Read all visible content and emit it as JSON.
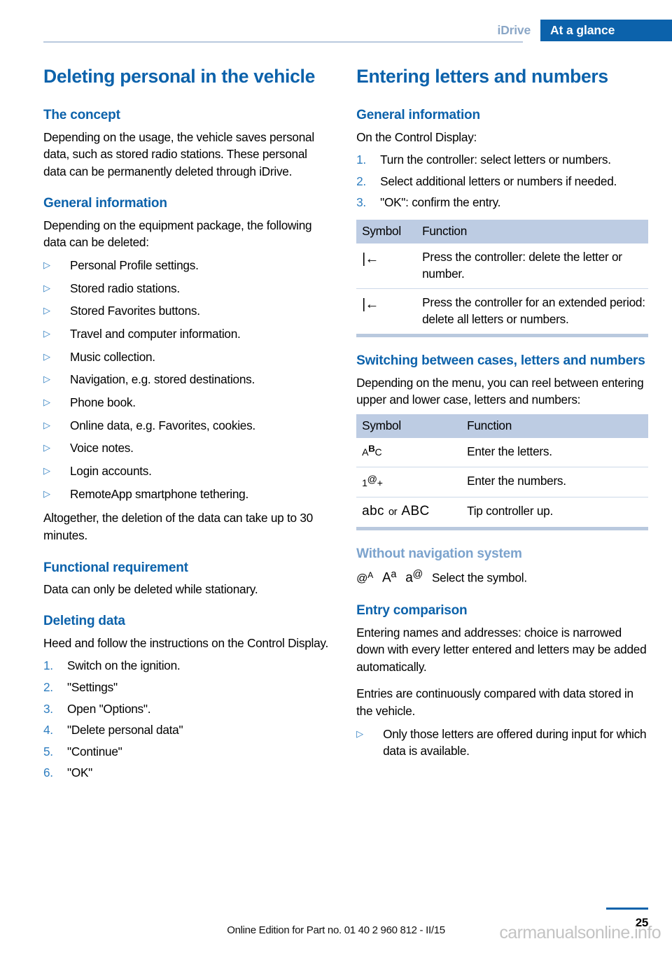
{
  "header": {
    "section": "iDrive",
    "chapter": "At a glance"
  },
  "left_column": {
    "title": "Deleting personal in the vehicle",
    "concept": {
      "heading": "The concept",
      "paragraph": "Depending on the usage, the vehicle saves personal data, such as stored radio stations. These personal data can be permanently deleted through iDrive."
    },
    "general_information": {
      "heading": "General information",
      "paragraph": "Depending on the equipment package, the following data can be deleted:",
      "bullet_marker": "▷",
      "items": [
        "Personal Profile settings.",
        "Stored radio stations.",
        "Stored Favorites buttons.",
        "Travel and computer information.",
        "Music collection.",
        "Navigation, e.g. stored destinations.",
        "Phone book.",
        "Online data, e.g. Favorites, cookies.",
        "Voice notes.",
        "Login accounts.",
        "RemoteApp smartphone tethering."
      ],
      "closing_paragraph": "Altogether, the deletion of the data can take up to 30 minutes."
    },
    "functional_requirement": {
      "heading": "Functional requirement",
      "paragraph": "Data can only be deleted while stationary."
    },
    "deleting_data": {
      "heading": "Deleting data",
      "paragraph": "Heed and follow the instructions on the Control Display.",
      "steps": [
        {
          "num": "1.",
          "text": "Switch on the ignition."
        },
        {
          "num": "2.",
          "text": "\"Settings\""
        },
        {
          "num": "3.",
          "text": "Open \"Options\"."
        },
        {
          "num": "4.",
          "text": "\"Delete personal data\""
        },
        {
          "num": "5.",
          "text": "\"Continue\""
        },
        {
          "num": "6.",
          "text": "\"OK\""
        }
      ]
    }
  },
  "right_column": {
    "title": "Entering letters and numbers",
    "general_information": {
      "heading": "General information",
      "paragraph": "On the Control Display:",
      "steps": [
        {
          "num": "1.",
          "text": "Turn the controller: select letters or numbers."
        },
        {
          "num": "2.",
          "text": "Select additional letters or numbers if needed."
        },
        {
          "num": "3.",
          "text": "\"OK\": confirm the entry."
        }
      ]
    },
    "table_delete": {
      "columns": [
        "Symbol",
        "Function"
      ],
      "rows": [
        {
          "symbol": "|←",
          "symbol_name": "backspace-icon",
          "function": "Press the controller: delete the letter or number."
        },
        {
          "symbol": "|←",
          "symbol_name": "backspace-long-icon",
          "function": "Press the controller for an extended period: delete all letters or numbers."
        }
      ]
    },
    "switching": {
      "heading": "Switching between cases, letters and numbers",
      "paragraph": "Depending on the menu, you can reel between entering upper and lower case, letters and numbers:"
    },
    "table_cases": {
      "columns": [
        "Symbol",
        "Function"
      ],
      "rows": [
        {
          "symbol_base": "A",
          "symbol_sup": "B",
          "symbol_tail": "C",
          "symbol_name": "abc-letters-icon",
          "function": "Enter the letters."
        },
        {
          "symbol_base": "1",
          "symbol_sup": "@",
          "symbol_tail": "+",
          "symbol_name": "numbers-symbols-icon",
          "function": "Enter the numbers."
        },
        {
          "symbol_lower": "abc",
          "symbol_or": "or",
          "symbol_upper": "ABC",
          "symbol_name": "case-toggle-icon",
          "function": "Tip controller up."
        }
      ]
    },
    "without_nav": {
      "heading": "Without navigation system",
      "symbols": [
        {
          "base": "@",
          "sup": "A",
          "name": "at-uppercase-icon"
        },
        {
          "base": "A",
          "sup": "a",
          "name": "uppercase-lowercase-icon"
        },
        {
          "base": "a",
          "sup": "@",
          "name": "lowercase-at-icon"
        }
      ],
      "text": "Select the symbol."
    },
    "entry_comparison": {
      "heading": "Entry comparison",
      "paragraph_1": "Entering names and addresses: choice is narrowed down with every letter entered and letters may be added automatically.",
      "paragraph_2": "Entries are continuously compared with data stored in the vehicle.",
      "bullet_marker": "▷",
      "bullets": [
        "Only those letters are offered during input for which data is available."
      ]
    }
  },
  "footer": {
    "edition": "Online Edition for Part no. 01 40 2 960 812 - II/15",
    "page_number": "25",
    "watermark": "carmanualsonline.info"
  }
}
